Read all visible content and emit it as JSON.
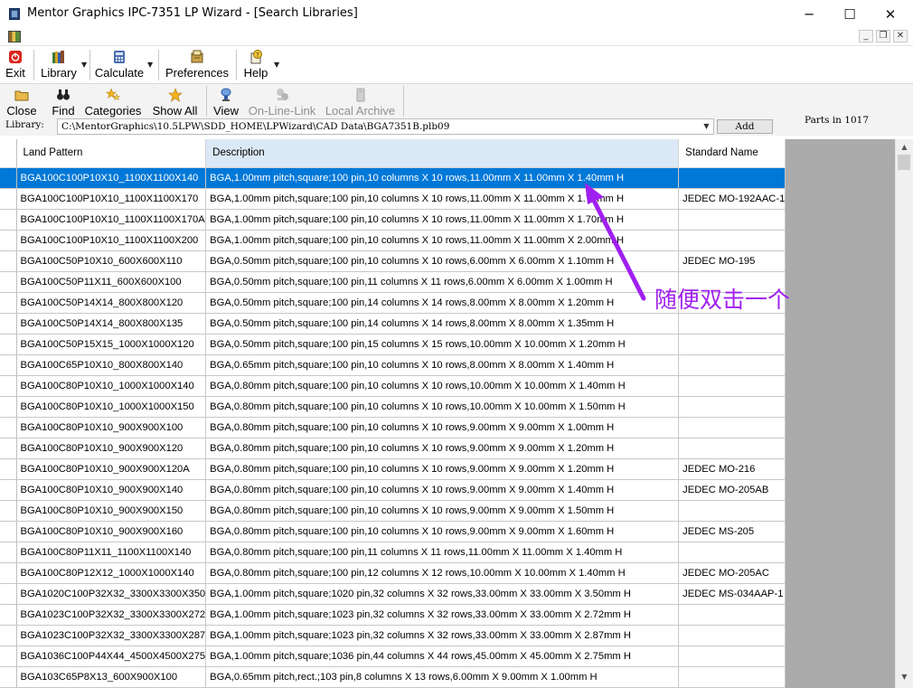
{
  "window": {
    "title": "Mentor Graphics IPC-7351 LP Wizard  - [Search Libraries]",
    "controls": {
      "minimize": "─",
      "maximize": "☐",
      "close": "✕"
    },
    "mdi_controls": {
      "minimize": "_",
      "restore": "❐",
      "close": "✕"
    }
  },
  "menubar": {
    "items": [
      {
        "label": "Exit",
        "icon": "exit-icon",
        "dropdown": false
      },
      {
        "label": "Library",
        "icon": "books-icon",
        "dropdown": true
      },
      {
        "label": "Calculate",
        "icon": "calculator-icon",
        "dropdown": true
      },
      {
        "label": "Preferences",
        "icon": "preferences-icon",
        "dropdown": false
      },
      {
        "label": "Help",
        "icon": "help-icon",
        "dropdown": true
      }
    ]
  },
  "toolbar": {
    "items": [
      {
        "label": "Close",
        "icon": "folder-open-icon",
        "enabled": true
      },
      {
        "label": "Find",
        "icon": "binoculars-icon",
        "enabled": true
      },
      {
        "label": "Categories",
        "icon": "stars-icon",
        "enabled": true
      },
      {
        "label": "Show All",
        "icon": "star-icon",
        "enabled": true
      },
      {
        "label": "View",
        "icon": "view-icon",
        "enabled": true
      },
      {
        "label": "On-Line-Link",
        "icon": "online-link-icon",
        "enabled": false
      },
      {
        "label": "Local Archive",
        "icon": "archive-icon",
        "enabled": false
      }
    ]
  },
  "library": {
    "label": "Library:",
    "path": "C:\\MentorGraphics\\10.5LPW\\SDD_HOME\\LPWizard\\CAD Data\\BGA7351B.plb09",
    "add_label": "Add",
    "parts_text": "Parts in 1017"
  },
  "grid": {
    "columns": [
      "Land Pattern",
      "Description",
      "Standard Name"
    ],
    "selected_index": 0,
    "rows": [
      [
        "BGA100C100P10X10_1100X1100X140",
        "BGA,1.00mm pitch,square;100 pin,10 columns X 10 rows,11.00mm X 11.00mm X 1.40mm H",
        ""
      ],
      [
        "BGA100C100P10X10_1100X1100X170",
        "BGA,1.00mm pitch,square;100 pin,10 columns X 10 rows,11.00mm X 11.00mm X 1.70mm H",
        "JEDEC MO-192AAC-1"
      ],
      [
        "BGA100C100P10X10_1100X1100X170A",
        "BGA,1.00mm pitch,square;100 pin,10 columns X 10 rows,11.00mm X 11.00mm X 1.70mm H",
        ""
      ],
      [
        "BGA100C100P10X10_1100X1100X200",
        "BGA,1.00mm pitch,square;100 pin,10 columns X 10 rows,11.00mm X 11.00mm X 2.00mm H",
        ""
      ],
      [
        "BGA100C50P10X10_600X600X110",
        "BGA,0.50mm pitch,square;100 pin,10 columns X 10 rows,6.00mm X 6.00mm X 1.10mm H",
        "JEDEC MO-195"
      ],
      [
        "BGA100C50P11X11_600X600X100",
        "BGA,0.50mm pitch,square;100 pin,11 columns X 11 rows,6.00mm X 6.00mm X 1.00mm H",
        ""
      ],
      [
        "BGA100C50P14X14_800X800X120",
        "BGA,0.50mm pitch,square;100 pin,14 columns X 14 rows,8.00mm X 8.00mm X 1.20mm H",
        ""
      ],
      [
        "BGA100C50P14X14_800X800X135",
        "BGA,0.50mm pitch,square;100 pin,14 columns X 14 rows,8.00mm X 8.00mm X 1.35mm H",
        ""
      ],
      [
        "BGA100C50P15X15_1000X1000X120",
        "BGA,0.50mm pitch,square;100 pin,15 columns X 15 rows,10.00mm X 10.00mm X 1.20mm H",
        ""
      ],
      [
        "BGA100C65P10X10_800X800X140",
        "BGA,0.65mm pitch,square;100 pin,10 columns X 10 rows,8.00mm X 8.00mm X 1.40mm H",
        ""
      ],
      [
        "BGA100C80P10X10_1000X1000X140",
        "BGA,0.80mm pitch,square;100 pin,10 columns X 10 rows,10.00mm X 10.00mm X 1.40mm H",
        ""
      ],
      [
        "BGA100C80P10X10_1000X1000X150",
        "BGA,0.80mm pitch,square;100 pin,10 columns X 10 rows,10.00mm X 10.00mm X 1.50mm H",
        ""
      ],
      [
        "BGA100C80P10X10_900X900X100",
        "BGA,0.80mm pitch,square;100 pin,10 columns X 10 rows,9.00mm X 9.00mm X 1.00mm H",
        ""
      ],
      [
        "BGA100C80P10X10_900X900X120",
        "BGA,0.80mm pitch,square;100 pin,10 columns X 10 rows,9.00mm X 9.00mm X 1.20mm H",
        ""
      ],
      [
        "BGA100C80P10X10_900X900X120A",
        "BGA,0.80mm pitch,square;100 pin,10 columns X 10 rows,9.00mm X 9.00mm X 1.20mm H",
        "JEDEC MO-216"
      ],
      [
        "BGA100C80P10X10_900X900X140",
        "BGA,0.80mm pitch,square;100 pin,10 columns X 10 rows,9.00mm X 9.00mm X 1.40mm H",
        "JEDEC MO-205AB"
      ],
      [
        "BGA100C80P10X10_900X900X150",
        "BGA,0.80mm pitch,square;100 pin,10 columns X 10 rows,9.00mm X 9.00mm X 1.50mm H",
        ""
      ],
      [
        "BGA100C80P10X10_900X900X160",
        "BGA,0.80mm pitch,square;100 pin,10 columns X 10 rows,9.00mm X 9.00mm X 1.60mm H",
        "JEDEC MS-205"
      ],
      [
        "BGA100C80P11X11_1100X1100X140",
        "BGA,0.80mm pitch,square;100 pin,11 columns X 11 rows,11.00mm X 11.00mm X 1.40mm H",
        ""
      ],
      [
        "BGA100C80P12X12_1000X1000X140",
        "BGA,0.80mm pitch,square;100 pin,12 columns X 12 rows,10.00mm X 10.00mm X 1.40mm H",
        "JEDEC MO-205AC"
      ],
      [
        "BGA1020C100P32X32_3300X3300X350",
        "BGA,1.00mm pitch,square;1020 pin,32 columns X 32 rows,33.00mm X 33.00mm X 3.50mm H",
        "JEDEC MS-034AAP-1"
      ],
      [
        "BGA1023C100P32X32_3300X3300X272",
        "BGA,1.00mm pitch,square;1023 pin,32 columns X 32 rows,33.00mm X 33.00mm X 2.72mm H",
        ""
      ],
      [
        "BGA1023C100P32X32_3300X3300X287",
        "BGA,1.00mm pitch,square;1023 pin,32 columns X 32 rows,33.00mm X 33.00mm X 2.87mm H",
        ""
      ],
      [
        "BGA1036C100P44X44_4500X4500X275",
        "BGA,1.00mm pitch,square;1036 pin,44 columns X 44 rows,45.00mm X 45.00mm X 2.75mm H",
        ""
      ],
      [
        "BGA103C65P8X13_600X900X100",
        "BGA,0.65mm pitch,rect.;103 pin,8 columns X 13 rows,6.00mm X 9.00mm X 1.00mm H",
        ""
      ]
    ]
  },
  "annotation": {
    "text": "随便双击一个",
    "color": "#a020f0"
  },
  "colors": {
    "selection": "#0078d7",
    "header_highlight": "#dbe8f6",
    "grid_background": "#ababab"
  }
}
